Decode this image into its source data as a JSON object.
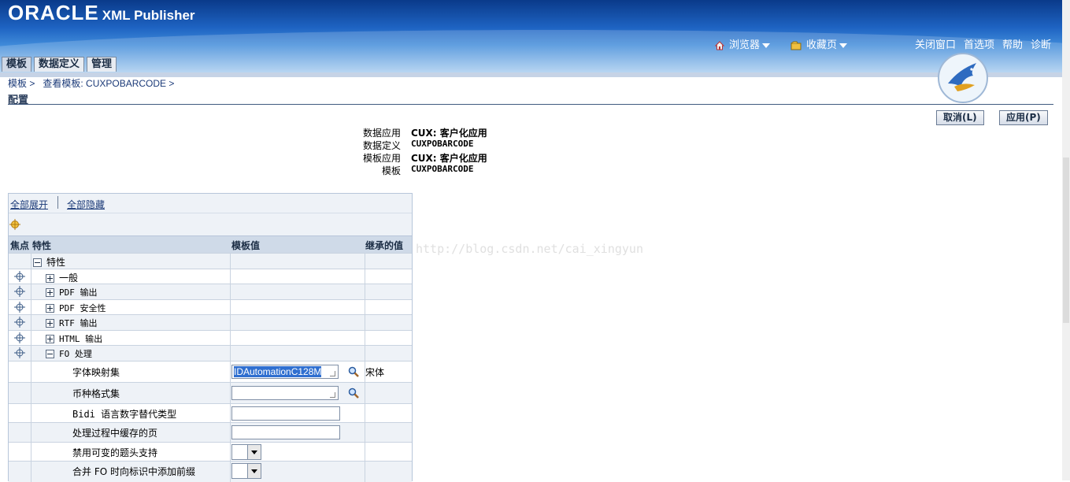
{
  "header": {
    "logo": "ORACLE",
    "product": "XML Publisher",
    "browser_menu": "浏览器",
    "favorites_menu": "收藏页",
    "global_links": [
      "关闭窗口",
      "首选项",
      "帮助",
      "诊断"
    ]
  },
  "tabs": [
    {
      "label": "模板",
      "active": true
    },
    {
      "label": "数据定义",
      "active": false
    },
    {
      "label": "管理",
      "active": false
    }
  ],
  "breadcrumb": [
    "模板 >",
    "查看模板: CUXPOBARCODE >"
  ],
  "page_title": "配置",
  "buttons": {
    "cancel": "取消(L)",
    "apply": "应用(P)"
  },
  "info": [
    {
      "label": "数据应用",
      "value": "CUX: 客户化应用"
    },
    {
      "label": "数据定义",
      "value": "CUXPOBARCODE"
    },
    {
      "label": "模板应用",
      "value": "CUX: 客户化应用"
    },
    {
      "label": "模板",
      "value": "CUXPOBARCODE"
    }
  ],
  "toolbar": {
    "expand_all": "全部展开",
    "collapse_all": "全部隐藏"
  },
  "columns": {
    "focus": "焦点",
    "property": "特性",
    "template_value": "模板值",
    "inherited": "继承的值"
  },
  "rows": {
    "root": "特性",
    "general": "一般",
    "pdf_output": "PDF 输出",
    "pdf_security": "PDF 安全性",
    "rtf_output": "RTF 输出",
    "html_output": "HTML 输出",
    "fo_processing": "FO 处理",
    "font_mapping": "字体映射集",
    "currency_format": "币种格式集",
    "bidi": "Bidi 语言数字替代类型",
    "cached_pages": "处理过程中缓存的页",
    "disable_variable_header": "禁用可变的题头支持",
    "merge_fo_prefix": "合并 FO 时向标识中添加前缀"
  },
  "values": {
    "font_mapping": "IDAutomationC128M",
    "font_mapping_inherited": "宋体"
  },
  "watermark": "http://blog.csdn.net/cai_xingyun"
}
